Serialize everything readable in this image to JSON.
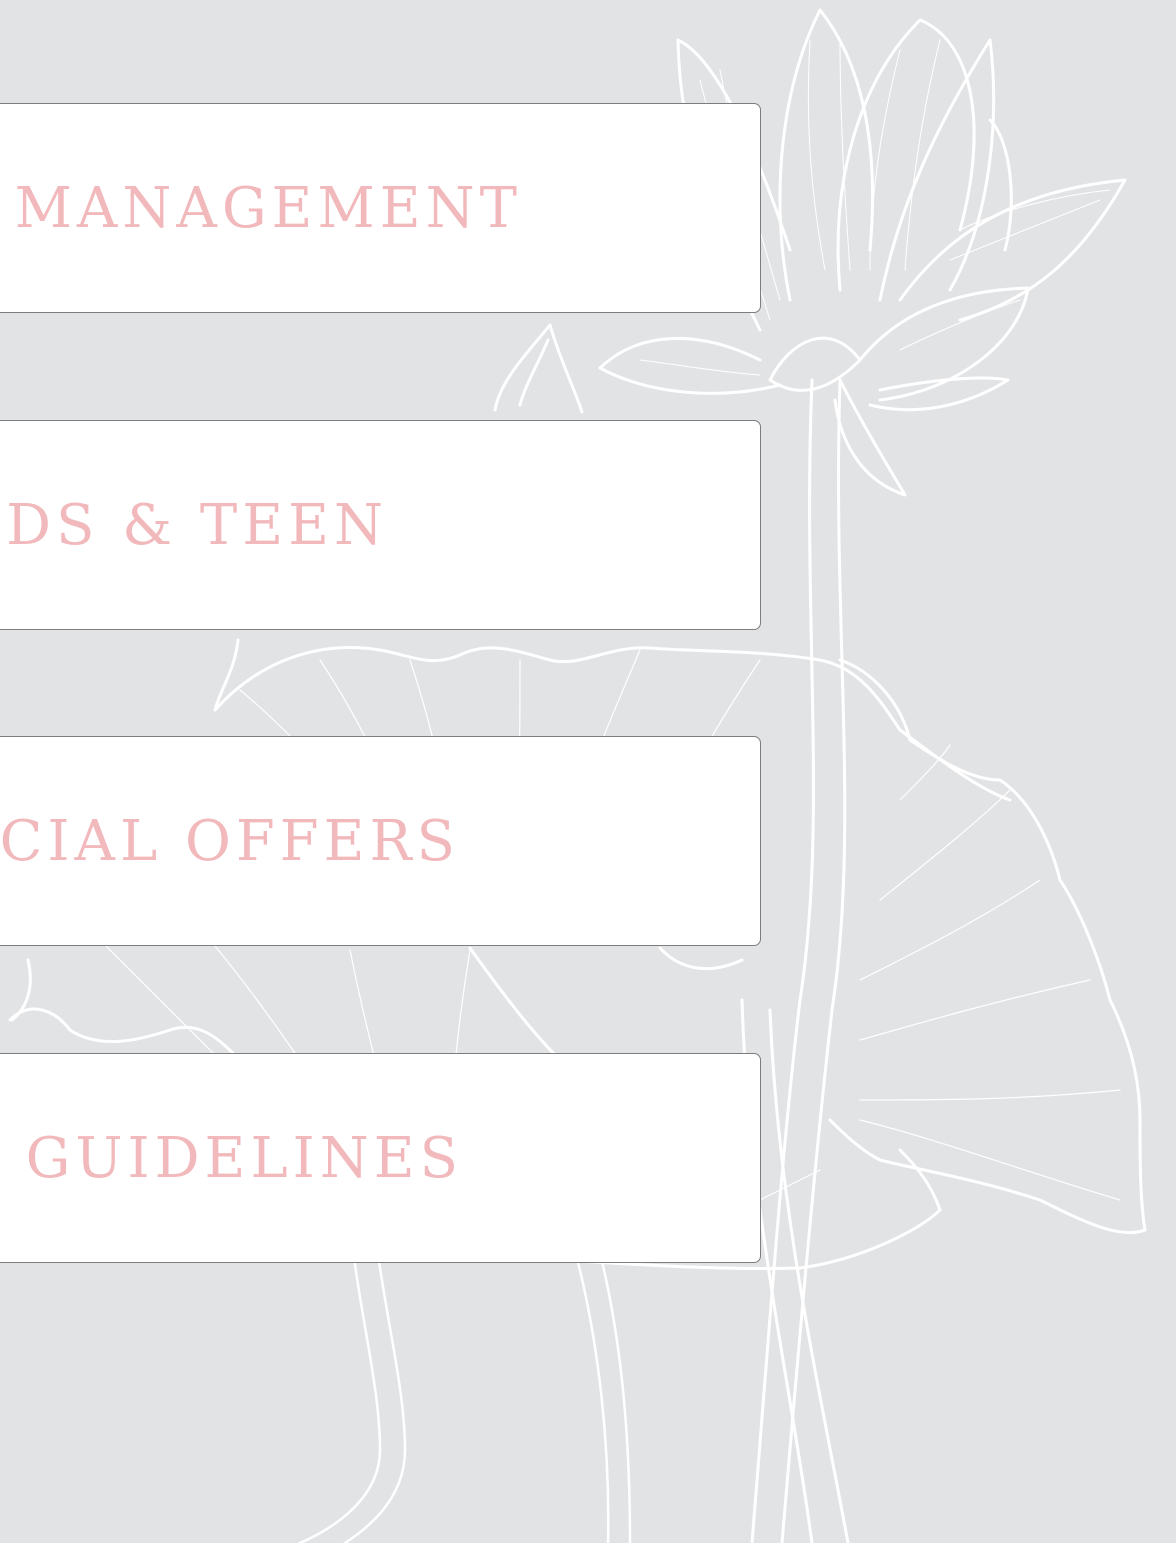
{
  "theme": {
    "background": "#e2e3e5",
    "card_background": "#ffffff",
    "card_border": "#7d7d7d",
    "label_color": "#f2b9bc",
    "line_art_color": "#ffffff"
  },
  "background_art": {
    "icon": "lotus-line-art-icon"
  },
  "menu": {
    "items": [
      {
        "label": "MANAGEMENT"
      },
      {
        "label": "IDS & TEEN"
      },
      {
        "label": "CIAL OFFERS"
      },
      {
        "label": "GUIDELINES"
      }
    ]
  }
}
